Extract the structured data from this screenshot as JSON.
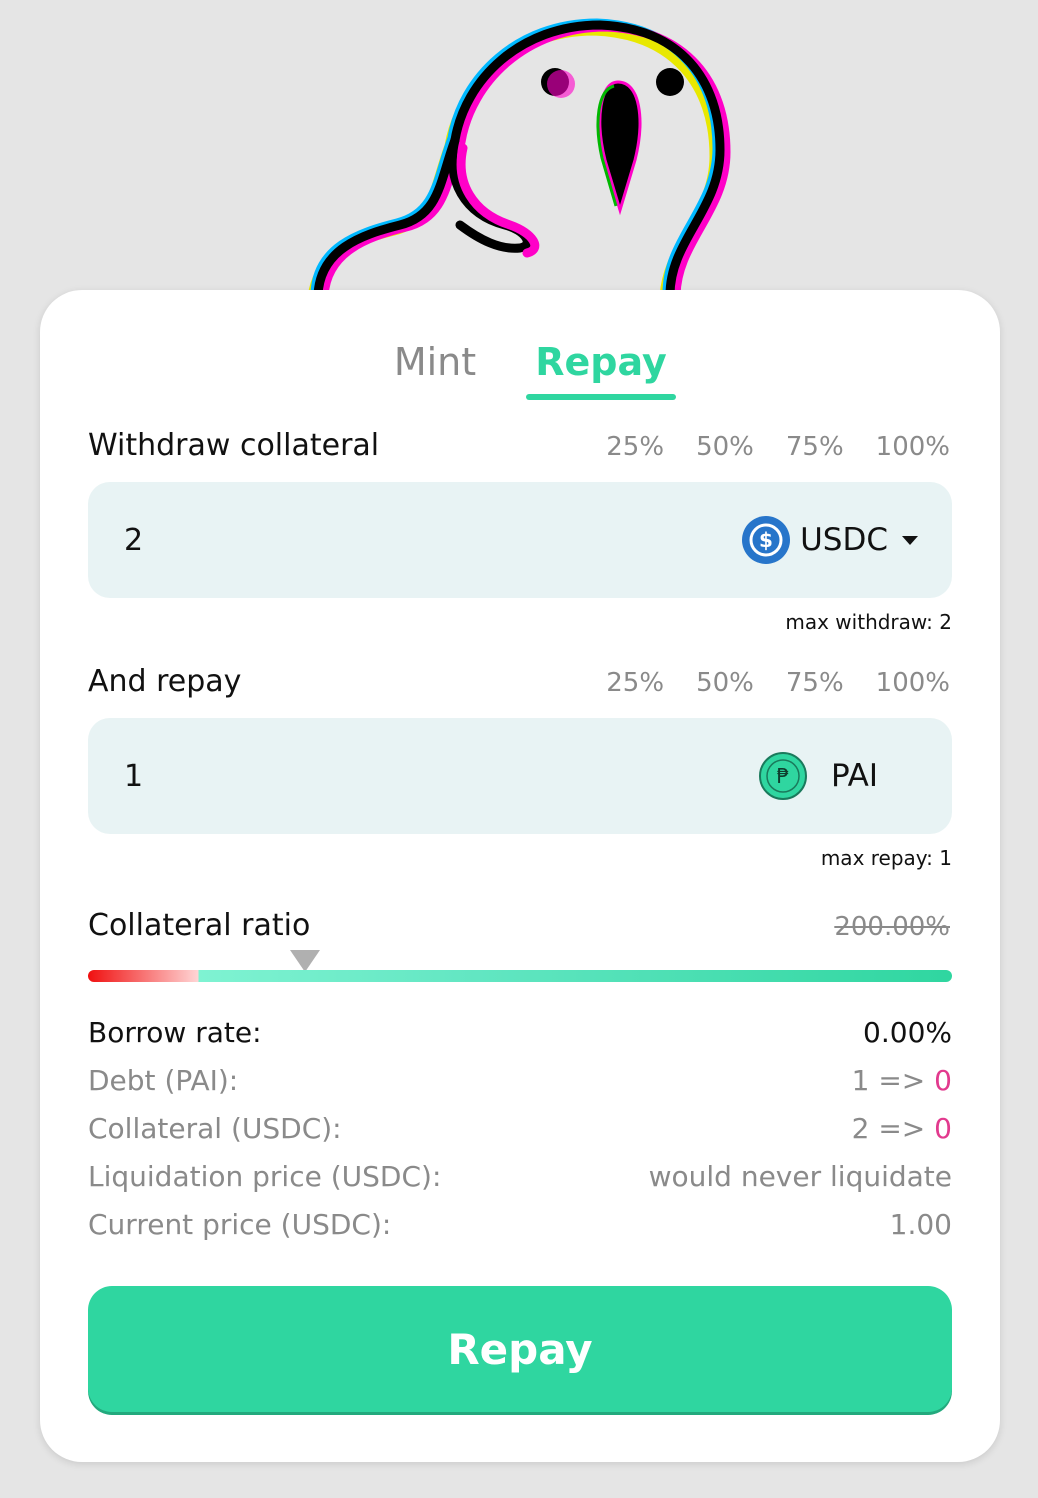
{
  "tabs": {
    "mint": "Mint",
    "repay": "Repay"
  },
  "withdraw": {
    "label": "Withdraw collateral",
    "percents": [
      "25%",
      "50%",
      "75%",
      "100%"
    ],
    "value": "2",
    "token": "USDC",
    "token_icon": "usdc-coin-icon",
    "max_note": "max withdraw: 2"
  },
  "repay": {
    "label": "And repay",
    "percents": [
      "25%",
      "50%",
      "75%",
      "100%"
    ],
    "value": "1",
    "token": "PAI",
    "token_icon": "pai-coin-icon",
    "max_note": "max repay: 1"
  },
  "ratio": {
    "label": "Collateral ratio",
    "value": "200.00%"
  },
  "stats": {
    "borrow_rate": {
      "label": "Borrow rate:",
      "value": "0.00%"
    },
    "debt": {
      "label": "Debt (PAI):",
      "from": "1 =>",
      "to": "0"
    },
    "collateral": {
      "label": "Collateral (USDC):",
      "from": "2 =>",
      "to": "0"
    },
    "liquidation": {
      "label": "Liquidation price (USDC):",
      "value": "would never liquidate"
    },
    "current_price": {
      "label": "Current price (USDC):",
      "value": "1.00"
    }
  },
  "button": {
    "label": "Repay"
  },
  "colors": {
    "accent": "#2fd6a0",
    "field_bg": "#e8f3f4",
    "muted": "#8a8a8a",
    "pink": "#e23a8e",
    "usdc": "#2775ca"
  }
}
